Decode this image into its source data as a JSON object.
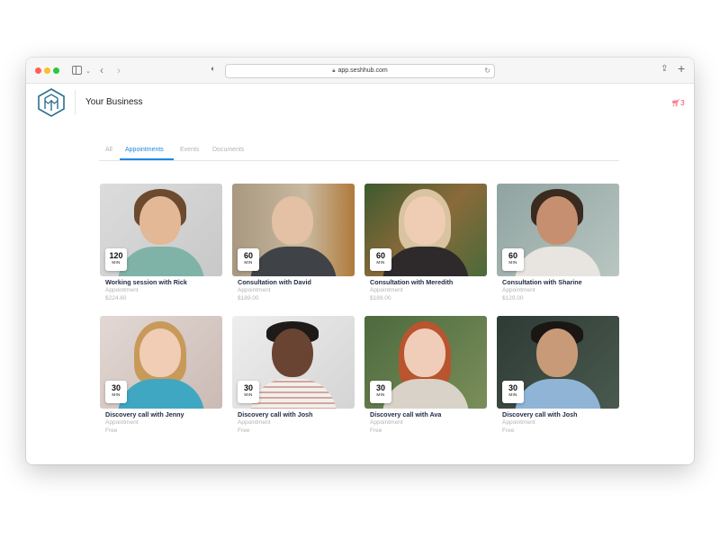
{
  "browser": {
    "url": "app.seshhub.com"
  },
  "header": {
    "business_name": "Your Business",
    "cart_count": "3"
  },
  "tabs": [
    {
      "label": "All",
      "active": false
    },
    {
      "label": "Appointments",
      "active": true
    },
    {
      "label": "Events",
      "active": false
    },
    {
      "label": "Documents",
      "active": false
    }
  ],
  "cards": [
    {
      "title": "Working session with Rick",
      "type": "Appointment",
      "price": "$224.60",
      "duration": "120",
      "unit": "MIN"
    },
    {
      "title": "Consultation with David",
      "type": "Appointment",
      "price": "$189.00",
      "duration": "60",
      "unit": "MIN"
    },
    {
      "title": "Consultation with Meredith",
      "type": "Appointment",
      "price": "$189.00",
      "duration": "60",
      "unit": "MIN"
    },
    {
      "title": "Consultation with Sharine",
      "type": "Appointment",
      "price": "$129.00",
      "duration": "60",
      "unit": "MIN"
    },
    {
      "title": "Discovery call with Jenny",
      "type": "Appointment",
      "price": "Free",
      "duration": "30",
      "unit": "MIN"
    },
    {
      "title": "Discovery call with Josh",
      "type": "Appointment",
      "price": "Free",
      "duration": "30",
      "unit": "MIN"
    },
    {
      "title": "Discovery call with Ava",
      "type": "Appointment",
      "price": "Free",
      "duration": "30",
      "unit": "MIN"
    },
    {
      "title": "Discovery call with Josh",
      "type": "Appointment",
      "price": "Free",
      "duration": "30",
      "unit": "MIN"
    }
  ],
  "icons": {
    "logo": "seshhub-logo-icon",
    "cart": "cart-icon"
  },
  "colors": {
    "accent": "#1e88e5",
    "cart": "#e8455c",
    "logo": "#2a6f8f"
  }
}
